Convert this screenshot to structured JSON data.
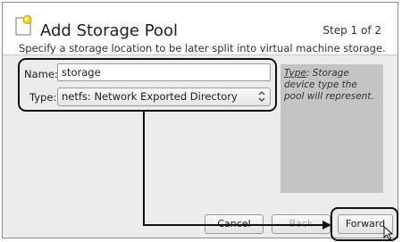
{
  "dialog": {
    "title": "Add Storage Pool",
    "step": "Step 1 of 2",
    "subtitle": "Specify a storage location to be later split into virtual machine storage."
  },
  "form": {
    "name_label": "Name:",
    "name_value": "storage",
    "type_label": "Type:",
    "type_selected": "netfs: Network Exported Directory"
  },
  "help": {
    "term": "Type",
    "text": ": Storage device type the pool will represent."
  },
  "buttons": {
    "cancel": "Cancel",
    "back": "Back",
    "forward": "Forward"
  },
  "icons": [
    "storage-pool-icon",
    "select-arrows-icon",
    "mouse-cursor-icon"
  ]
}
